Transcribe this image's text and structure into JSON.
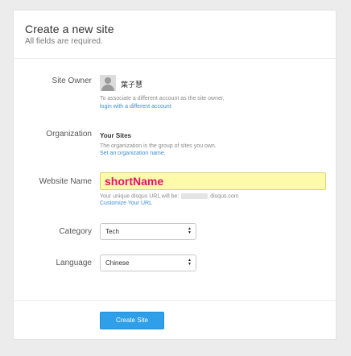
{
  "header": {
    "title": "Create a new site",
    "subtitle": "All fields are required."
  },
  "site_owner": {
    "label": "Site Owner",
    "avatar_icon": "user-avatar-icon",
    "name": "葉子慧",
    "help": "To associate a different account as the site owner,",
    "link": "login with a different account"
  },
  "organization": {
    "label": "Organization",
    "value": "Your Sites",
    "help": "The organization is the group of sites you own.",
    "link": "Set an organization name."
  },
  "website_name": {
    "label": "Website Name",
    "value": "shortName",
    "url_prefix": "Your unique disqus URL will be:",
    "url_suffix": ".disqus.com",
    "link": "Customize Your URL"
  },
  "category": {
    "label": "Category",
    "selected": "Tech"
  },
  "language": {
    "label": "Language",
    "selected": "Chinese"
  },
  "footer": {
    "create_button": "Create Site"
  },
  "colors": {
    "primary_button": "#2e9fe8",
    "link": "#3f8fd6",
    "input_highlight": "#fdfba9",
    "input_text": "#e0136f"
  }
}
